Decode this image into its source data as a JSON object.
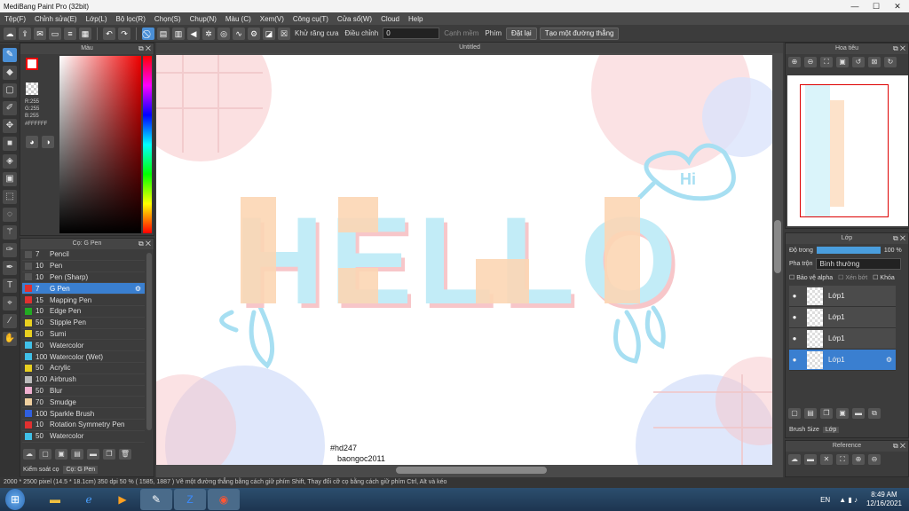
{
  "window": {
    "title": "MediBang Paint Pro (32bit)",
    "minimize": "—",
    "maximize": "☐",
    "close": "✕"
  },
  "menu": [
    "Tệp(F)",
    "Chỉnh sửa(E)",
    "Lớp(L)",
    "Bộ lọc(R)",
    "Chọn(S)",
    "Chụp(N)",
    "Màu (C)",
    "Xem(V)",
    "Công cụ(T)",
    "Cửa sổ(W)",
    "Cloud",
    "Help"
  ],
  "toolbar": {
    "antialias": "Khử răng cưa",
    "adjust": "Điều chỉnh",
    "adjust_value": "0",
    "smooth": "Cạnh mềm",
    "key": "Phím",
    "reset": "Đặt lại",
    "straight": "Tạo một đường thẳng"
  },
  "canvas": {
    "tab": "Untitled",
    "watermark_1": "#hd247",
    "watermark_2": "baongoc2011",
    "art_text": "HELLO",
    "bubble_text": "Hi"
  },
  "color_panel": {
    "title": "Màu",
    "r": "R:255",
    "g": "G:255",
    "b": "B:255",
    "hex": "#FFFFFF"
  },
  "brush_panel": {
    "title": "Cọ: G Pen",
    "brushes": [
      {
        "size": "7",
        "name": "Pencil",
        "color": "#555555"
      },
      {
        "size": "10",
        "name": "Pen",
        "color": "#555555"
      },
      {
        "size": "10",
        "name": "Pen (Sharp)",
        "color": "#555555"
      },
      {
        "size": "7",
        "name": "G Pen",
        "color": "#e03030"
      },
      {
        "size": "15",
        "name": "Mapping Pen",
        "color": "#e03030"
      },
      {
        "size": "10",
        "name": "Edge Pen",
        "color": "#22aa22"
      },
      {
        "size": "50",
        "name": "Stipple Pen",
        "color": "#e8d020"
      },
      {
        "size": "50",
        "name": "Sumi",
        "color": "#e8d020"
      },
      {
        "size": "50",
        "name": "Watercolor",
        "color": "#40c0e8"
      },
      {
        "size": "100",
        "name": "Watercolor (Wet)",
        "color": "#40c0e8"
      },
      {
        "size": "50",
        "name": "Acrylic",
        "color": "#e8d020"
      },
      {
        "size": "100",
        "name": "Airbrush",
        "color": "#bbbbbb"
      },
      {
        "size": "50",
        "name": "Blur",
        "color": "#f0b0d0"
      },
      {
        "size": "70",
        "name": "Smudge",
        "color": "#f0d0a0"
      },
      {
        "size": "100",
        "name": "Sparkle Brush",
        "color": "#3060e0"
      },
      {
        "size": "10",
        "name": "Rotation Symmetry Pen",
        "color": "#e03030"
      },
      {
        "size": "50",
        "name": "Watercolor",
        "color": "#40c0e8"
      }
    ],
    "tab_1": "Kiểm soát cọ",
    "tab_2": "Cọ: G Pen"
  },
  "navigator": {
    "title": "Hoa tiêu"
  },
  "layers_panel": {
    "title": "Lớp",
    "opacity_label": "Độ trong",
    "opacity_value": "100 %",
    "blend_label": "Pha trộn",
    "blend_value": "Bình thường",
    "protect_alpha": "Bảo vệ alpha",
    "clip": "Xén bớt",
    "lock": "Khóa",
    "layers": [
      "Lớp1",
      "Lớp1",
      "Lớp1",
      "Lớp1"
    ],
    "tab_1": "Brush Size",
    "tab_2": "Lớp"
  },
  "reference": {
    "title": "Reference"
  },
  "status": "2000 * 2500 pixel   (14.5 * 18.1cm)   350 dpi   50 %   ( 1585, 1887 )   Vẽ một đường thẳng bằng cách giữ phím Shift, Thay đổi cỡ cọ bằng cách giữ phím Ctrl, Alt và kéo",
  "taskbar": {
    "lang": "EN",
    "time": "8:49 AM",
    "date": "12/16/2021"
  },
  "colors": {
    "accent": "#3a7fd0",
    "peach": "#fcd6b4",
    "lightblue": "#c2ecf7",
    "pink": "#f7c6c9"
  }
}
